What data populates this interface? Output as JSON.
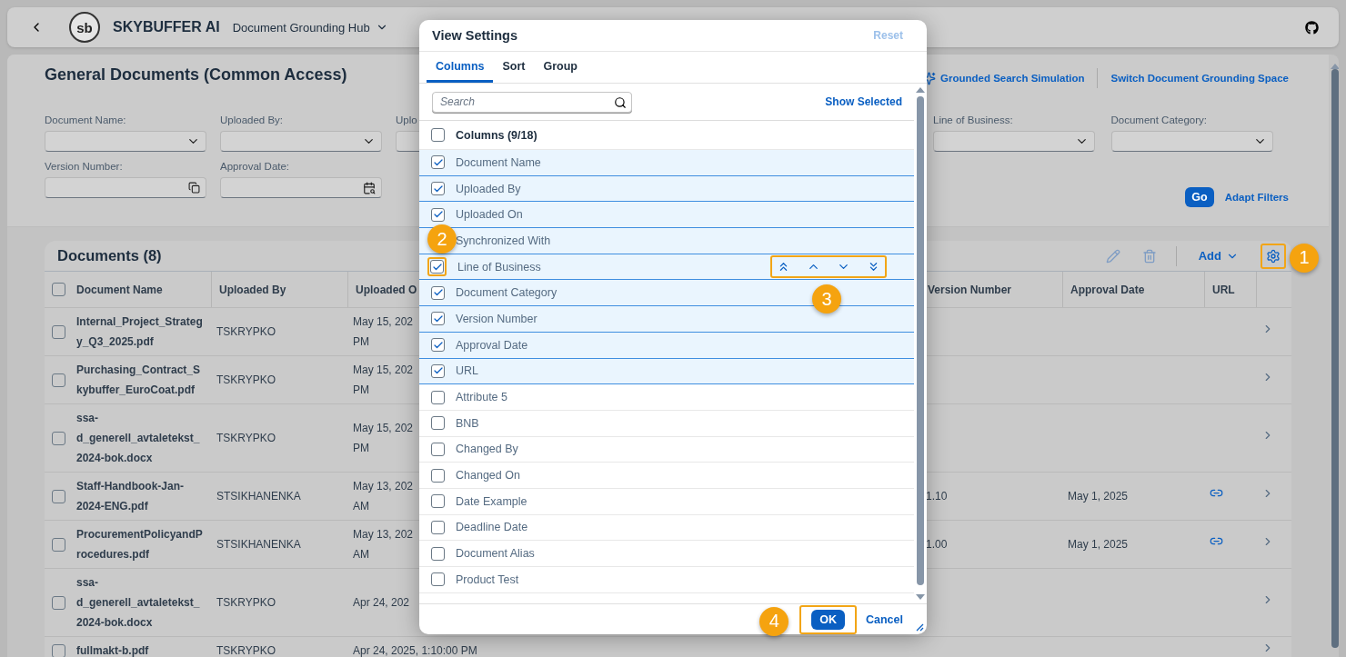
{
  "shell": {
    "logo_text": "sb",
    "brand": "SKYBUFFER AI",
    "app_title": "Document Grounding Hub"
  },
  "page": {
    "title": "General Documents (Common Access)",
    "actions": [
      {
        "label": "Grounded Search Simulation",
        "kind": "sparkle"
      },
      {
        "label": "Switch Document Grounding Space",
        "kind": "plain"
      }
    ]
  },
  "filter_rows": [
    [
      {
        "label": "Document Name:",
        "kind": "select"
      },
      {
        "label": "Uploaded By:",
        "kind": "select"
      },
      {
        "label": "Uplo",
        "kind": "select"
      },
      {
        "label": "Line of Business:",
        "kind": "select"
      },
      {
        "label": "Document Category:",
        "kind": "select"
      }
    ],
    [
      {
        "label": "Version Number:",
        "kind": "copy"
      },
      {
        "label": "Approval Date:",
        "kind": "date"
      }
    ]
  ],
  "filter_buttons": {
    "go": "Go",
    "adapt": "Adapt Filters"
  },
  "table": {
    "title": "Documents (8)",
    "toolbar": [
      {
        "kind": "edit",
        "disabled": true
      },
      {
        "kind": "delete",
        "disabled": true
      },
      {
        "kind": "menu",
        "label": "Add"
      },
      {
        "kind": "settings",
        "callout": "1"
      }
    ],
    "all_selected": false,
    "columns_left": [
      "Document Name",
      "Uploaded By",
      "Uploaded O"
    ],
    "columns_right": [
      "Version Number",
      "Approval Date",
      "URL"
    ],
    "rows": [
      {
        "selected": false,
        "name": "Internal_Project_Strategy_Q3_2025.pdf",
        "uploaded_by": "TSKRYPKO",
        "uploaded_on": [
          "May 15, 202",
          "PM"
        ],
        "has_link": false
      },
      {
        "selected": false,
        "name": "Purchasing_Contract_Skybuffer_EuroCoat.pdf",
        "uploaded_by": "TSKRYPKO",
        "uploaded_on": [
          "May 15, 202",
          "PM"
        ],
        "has_link": false
      },
      {
        "selected": false,
        "name": "ssa-d_generell_avtaletekst_2024-bok.docx",
        "uploaded_by": "TSKRYPKO",
        "uploaded_on": [
          "May 15, 202",
          "PM"
        ],
        "has_link": false
      },
      {
        "selected": false,
        "name": "Staff-Handbook-Jan-2024-ENG.pdf",
        "uploaded_by": "STSIKHANENKA",
        "uploaded_on": [
          "May 13, 202",
          "AM"
        ],
        "version": "1.10",
        "approval": "May 1, 2025",
        "has_link": true
      },
      {
        "selected": false,
        "name": "ProcurementPolicyandProcedures.pdf",
        "uploaded_by": "STSIKHANENKA",
        "uploaded_on": [
          "May 13, 202",
          "AM"
        ],
        "version": "1.00",
        "approval": "May 1, 2025",
        "has_link": true
      },
      {
        "selected": false,
        "name": "ssa-d_generell_avtaletekst_2024-bok.docx",
        "uploaded_by": "TSKRYPKO",
        "uploaded_on": [
          "Apr 24, 202"
        ],
        "has_link": false
      },
      {
        "selected": false,
        "name": "fullmakt-b.pdf",
        "uploaded_by": "TSKRYPKO",
        "uploaded_on": [
          "Apr 24, 2025, 1:10:00 PM"
        ],
        "has_link": false
      }
    ]
  },
  "dialog": {
    "title": "View Settings",
    "reset": {
      "label": "Reset",
      "disabled": true
    },
    "tabs": [
      {
        "label": "Columns",
        "selected": true
      },
      {
        "label": "Sort",
        "selected": false
      },
      {
        "label": "Group",
        "selected": false
      }
    ],
    "search": {
      "placeholder": "Search"
    },
    "show_selected": "Show Selected",
    "list_header": {
      "label": "Columns (9/18)",
      "checked": false
    },
    "move_buttons_callout": "3",
    "items": [
      {
        "label": "Document Name",
        "checked": true,
        "focused": false
      },
      {
        "label": "Uploaded By",
        "checked": true,
        "focused": false
      },
      {
        "label": "Uploaded On",
        "checked": true,
        "focused": false
      },
      {
        "label": "Synchronized With",
        "checked": true,
        "focused": false
      },
      {
        "label": "Line of Business",
        "checked": true,
        "focused": true,
        "callout": "2"
      },
      {
        "label": "Document Category",
        "checked": true,
        "focused": false
      },
      {
        "label": "Version Number",
        "checked": true,
        "focused": false
      },
      {
        "label": "Approval Date",
        "checked": true,
        "focused": false
      },
      {
        "label": "URL",
        "checked": true,
        "focused": false
      },
      {
        "label": "Attribute 5",
        "checked": false,
        "focused": false
      },
      {
        "label": "BNB",
        "checked": false,
        "focused": false
      },
      {
        "label": "Changed By",
        "checked": false,
        "focused": false
      },
      {
        "label": "Changed On",
        "checked": false,
        "focused": false
      },
      {
        "label": "Date Example",
        "checked": false,
        "focused": false
      },
      {
        "label": "Deadline Date",
        "checked": false,
        "focused": false
      },
      {
        "label": "Document Alias",
        "checked": false,
        "focused": false
      },
      {
        "label": "Product Test",
        "checked": false,
        "focused": false
      }
    ],
    "ok": {
      "label": "OK",
      "callout": "4"
    },
    "cancel": "Cancel"
  }
}
